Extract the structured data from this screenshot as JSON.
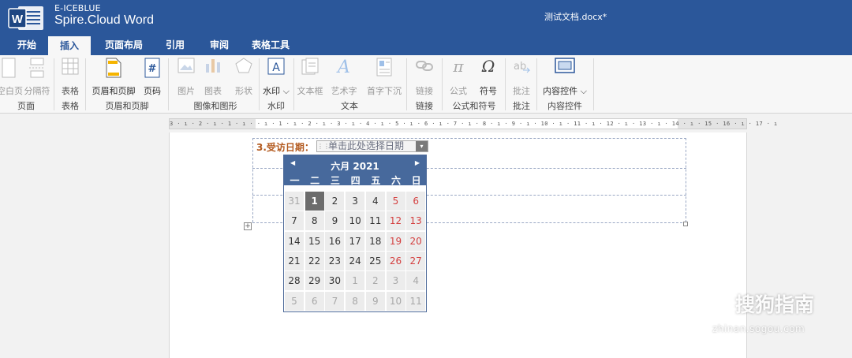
{
  "app": {
    "brand_small": "E-ICEBLUE",
    "brand_name": "Spire.Cloud Word",
    "document_title": "测试文档.docx*"
  },
  "tabs": [
    {
      "label": "开始",
      "active": false
    },
    {
      "label": "插入",
      "active": true
    },
    {
      "label": "页面布局",
      "active": false
    },
    {
      "label": "引用",
      "active": false
    },
    {
      "label": "审阅",
      "active": false
    },
    {
      "label": "表格工具",
      "active": false
    }
  ],
  "ribbon": {
    "buttons": {
      "blank_page": "空白页",
      "page_break": "分隔符",
      "table": "表格",
      "header_footer": "页眉和页脚",
      "page_number": "页码",
      "picture": "图片",
      "chart": "图表",
      "shape": "形状",
      "watermark": "水印",
      "textbox": "文本框",
      "wordart": "艺术字",
      "dropcap": "首字下沉",
      "link": "链接",
      "formula": "公式",
      "symbol": "符号",
      "comment": "批注",
      "content_control": "内容控件"
    },
    "groups": {
      "page": "页面",
      "table": "表格",
      "header_footer": "页眉和页脚",
      "image_shape": "图像和图形",
      "watermark": "水印",
      "text": "文本",
      "link": "链接",
      "formula_symbol": "公式和符号",
      "comment": "批注",
      "content_control": "内容控件"
    }
  },
  "ruler": {
    "text": "3 · ı · 2 · ı · 1 · ı ·    · ı · 1 · ı · 2 · ı · 3 · ı · 4 · ı · 5 · ı · 6 · ı · 7 · ı · 8 · ı · 9 · ı · 10 · ı · 11 · ı · 12 · ı · 13 · ı · 14 · ı · 15    · 16 · ı · 17 · ı"
  },
  "document": {
    "field_label": "3.受访日期：",
    "date_placeholder": "单击此处选择日期",
    "dropdown_glyph": "▾"
  },
  "calendar": {
    "title": "六月 2021",
    "prev_glyph": "◀",
    "next_glyph": "▶",
    "weekdays": [
      "一",
      "二",
      "三",
      "四",
      "五",
      "六",
      "日"
    ],
    "weeks": [
      [
        "31",
        "1",
        "2",
        "3",
        "4",
        "5",
        "6"
      ],
      [
        "7",
        "8",
        "9",
        "10",
        "11",
        "12",
        "13"
      ],
      [
        "14",
        "15",
        "16",
        "17",
        "18",
        "19",
        "20"
      ],
      [
        "21",
        "22",
        "23",
        "24",
        "25",
        "26",
        "27"
      ],
      [
        "28",
        "29",
        "30",
        "1",
        "2",
        "3",
        "4"
      ],
      [
        "5",
        "6",
        "7",
        "8",
        "9",
        "10",
        "11"
      ]
    ],
    "selected": {
      "week": 0,
      "day": 1
    },
    "colors": {
      "header": "#47699c",
      "weekend": "#d43f3f",
      "selected": "#6c6c6c"
    }
  },
  "watermark": {
    "text": "搜狗指南",
    "sub": "zhinan.sogou.com"
  },
  "colors": {
    "titlebar": "#2b579a",
    "accent": "#2b579a"
  }
}
